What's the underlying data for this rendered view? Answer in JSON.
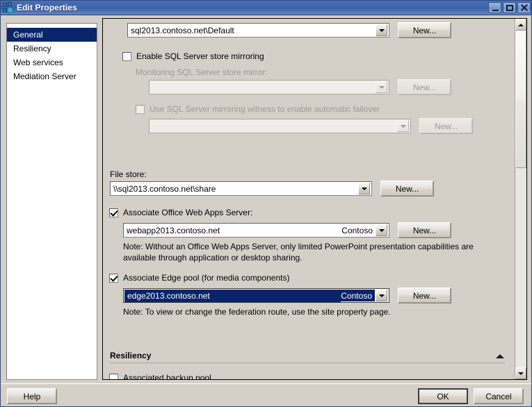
{
  "window": {
    "title": "Edit Properties",
    "icon": "app-icon",
    "controls": {
      "minimize": "minimize-icon",
      "maximize": "maximize-icon",
      "close": "close-icon"
    }
  },
  "sidebar": {
    "items": [
      {
        "label": "General",
        "selected": true
      },
      {
        "label": "Resiliency",
        "selected": false
      },
      {
        "label": "Web services",
        "selected": false
      },
      {
        "label": "Mediation Server",
        "selected": false
      }
    ]
  },
  "main": {
    "sql_store": {
      "value": "sql2013.contoso.net\\Default",
      "new_button": "New..."
    },
    "enable_mirroring": {
      "label": "Enable SQL Server store mirroring",
      "checked": false
    },
    "mirror_store": {
      "label": "Monitoring SQL Server store mirror:",
      "value": "",
      "new_button": "New...",
      "disabled": true
    },
    "mirroring_witness": {
      "label": "Use SQL Server mirroring witness to enable automatic failover",
      "checked": false,
      "disabled": true
    },
    "witness_store": {
      "value": "",
      "new_button": "New...",
      "disabled": true
    },
    "file_store": {
      "label": "File store:",
      "value": "\\\\sql2013.contoso.net\\share",
      "new_button": "New..."
    },
    "office_web_apps": {
      "label": "Associate Office Web Apps Server:",
      "checked": true,
      "value": "webapp2013.contoso.net",
      "value_right": "Contoso",
      "new_button": "New...",
      "note": "Note: Without an Office Web Apps Server, only limited PowerPoint presentation capabilities are available through application or desktop sharing."
    },
    "edge_pool": {
      "label": "Associate Edge pool (for media components)",
      "checked": true,
      "value": "edge2013.contoso.net",
      "value_right": "Contoso",
      "new_button": "New...",
      "note": "Note: To view or change the federation route, use the site property page.",
      "selected": true
    },
    "resiliency_section": {
      "title": "Resiliency",
      "collapse_icon": "chevron-up-icon"
    },
    "backup_pool": {
      "label": "Associated backup pool",
      "checked": false
    }
  },
  "footer": {
    "help": "Help",
    "ok": "OK",
    "cancel": "Cancel"
  },
  "colors": {
    "title_bar": "#3f64ad",
    "selection": "#0a246a",
    "dialog_face": "#d4d0c8"
  }
}
